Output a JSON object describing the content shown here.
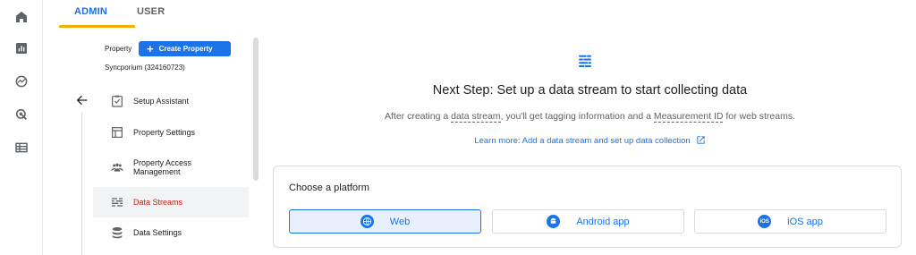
{
  "rail": {
    "icons": [
      "home-icon",
      "reports-icon",
      "explore-icon",
      "advertising-icon",
      "configure-icon"
    ]
  },
  "tabs": {
    "admin": "ADMIN",
    "user": "USER"
  },
  "property": {
    "label": "Property",
    "create_button": "Create Property",
    "name": "Syncporium (324160723)"
  },
  "nav": {
    "items": [
      {
        "label": "Setup Assistant"
      },
      {
        "label": "Property Settings"
      },
      {
        "label": "Property Access",
        "label2": "Management"
      },
      {
        "label": "Data Streams"
      },
      {
        "label": "Data Settings"
      }
    ]
  },
  "main": {
    "headline": "Next Step: Set up a data stream to start collecting data",
    "sub_before": "After creating a ",
    "sub_link1": "data stream",
    "sub_middle": ", you'll get tagging information and a ",
    "sub_link2": "Measurement ID",
    "sub_after": " for web streams.",
    "learn_more": "Learn more: Add a data stream and set up data collection"
  },
  "platform": {
    "title": "Choose a platform",
    "buttons": [
      {
        "label": "Web"
      },
      {
        "label": "Android app"
      },
      {
        "label": "iOS app",
        "icon_text": "iOS"
      }
    ]
  },
  "colors": {
    "accent": "#1a73e8",
    "active_nav": "#c5221f",
    "tab_underline": "#f9ab00"
  }
}
